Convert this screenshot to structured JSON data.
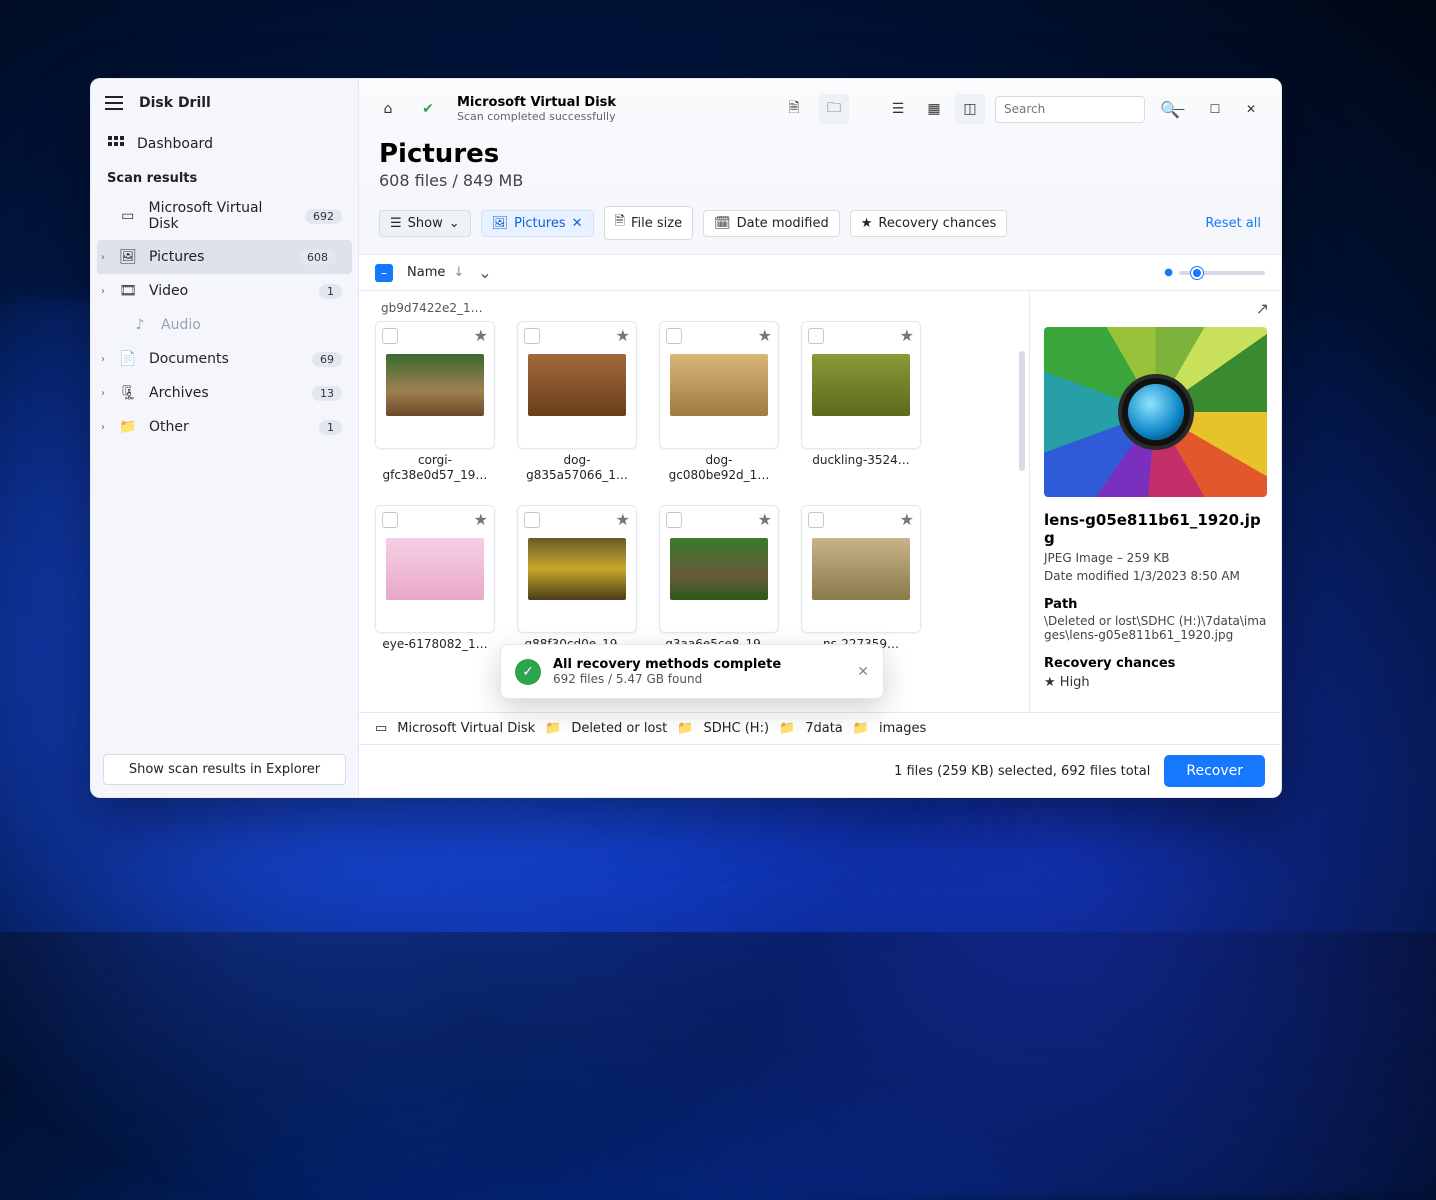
{
  "app": {
    "title": "Disk Drill"
  },
  "sidebar": {
    "dashboard": "Dashboard",
    "scan_results_heading": "Scan results",
    "disk": {
      "label": "Microsoft Virtual Disk",
      "count": "692"
    },
    "items": [
      {
        "label": "Pictures",
        "count": "608"
      },
      {
        "label": "Video",
        "count": "1"
      },
      {
        "label": "Audio",
        "count": ""
      },
      {
        "label": "Documents",
        "count": "69"
      },
      {
        "label": "Archives",
        "count": "13"
      },
      {
        "label": "Other",
        "count": "1"
      }
    ],
    "explorer_button": "Show scan results in Explorer"
  },
  "topbar": {
    "title": "Microsoft Virtual Disk",
    "subtitle": "Scan completed successfully",
    "search_placeholder": "Search"
  },
  "heading": {
    "title": "Pictures",
    "subtitle": "608 files / 849 MB"
  },
  "filters": {
    "show": "Show",
    "pictures": "Pictures",
    "file_size": "File size",
    "date_modified": "Date modified",
    "recovery": "Recovery chances",
    "reset": "Reset all"
  },
  "columns": {
    "name": "Name"
  },
  "partial_row_label": "gb9d7422e2_1…",
  "thumbs": [
    {
      "caption": "corgi-gfc38e0d57_19…",
      "cls": "corgi"
    },
    {
      "caption": "dog-g835a57066_1…",
      "cls": "dog1"
    },
    {
      "caption": "dog-gc080be92d_1…",
      "cls": "dog2"
    },
    {
      "caption": "duckling-3524…",
      "cls": "duck"
    },
    {
      "caption": "eye-6178082_1…",
      "cls": "blossom"
    },
    {
      "caption": "g88f30cd0e_19…",
      "cls": "gold"
    },
    {
      "caption": "g3aa6e5ce8_19…",
      "cls": "hedge"
    },
    {
      "caption": "ns-227359…",
      "cls": "kitten"
    }
  ],
  "breadcrumb": {
    "root": "Microsoft Virtual Disk",
    "p1": "Deleted or lost",
    "p2": "SDHC (H:)",
    "p3": "7data",
    "p4": "images"
  },
  "details": {
    "filename": "lens-g05e811b61_1920.jpg",
    "type_size": "JPEG Image – 259 KB",
    "modified": "Date modified 1/3/2023 8:50 AM",
    "path_label": "Path",
    "path": "\\Deleted or lost\\SDHC (H:)\\7data\\images\\lens-g05e811b61_1920.jpg",
    "chances_label": "Recovery chances",
    "chances_value": "High"
  },
  "footer": {
    "status": "1 files (259 KB) selected, 692 files total",
    "recover": "Recover"
  },
  "toast": {
    "title": "All recovery methods complete",
    "subtitle": "692 files / 5.47 GB found"
  }
}
